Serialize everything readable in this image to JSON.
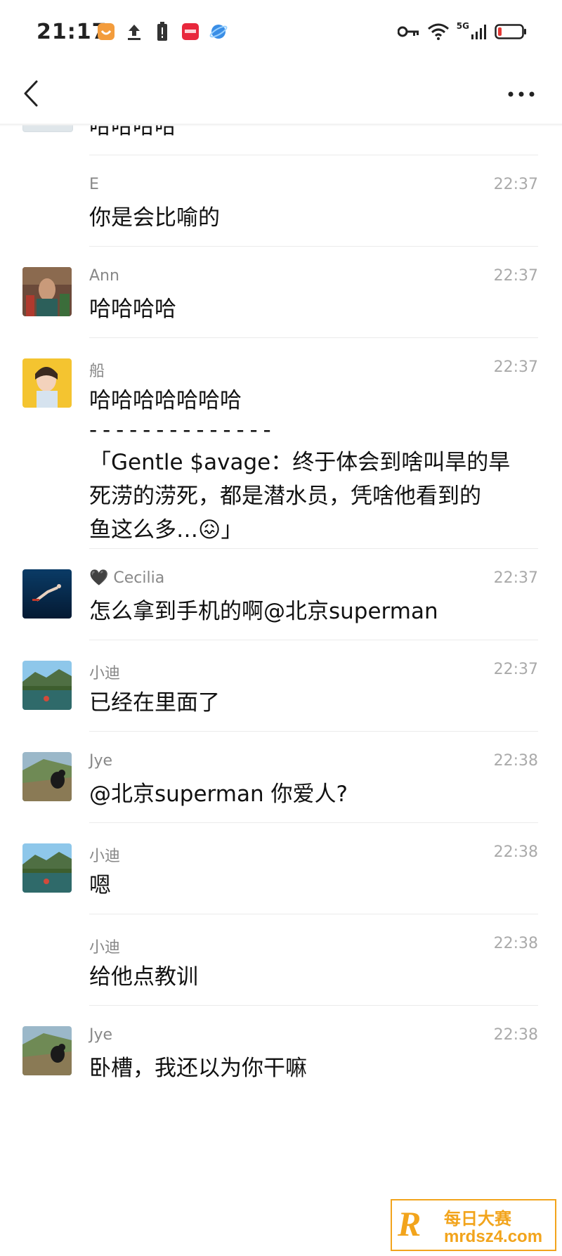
{
  "status_bar": {
    "time": "21:17",
    "network_type": "5G",
    "icons": [
      "app-notification-icon",
      "upload-icon",
      "alert-icon",
      "app-icon",
      "browser-icon",
      "key-icon",
      "wifi-icon",
      "signal-icon",
      "battery-low-icon"
    ],
    "battery_color": "#e53935"
  },
  "nav": {
    "back_icon": "chevron-left-icon",
    "more_icon": "more-dots-icon"
  },
  "messages": [
    {
      "sender": "",
      "time": "",
      "text": "哈哈哈哈",
      "avatar": "partial"
    },
    {
      "sender": "E",
      "time": "22:37",
      "text": "你是会比喻的",
      "avatar": "none"
    },
    {
      "sender": "Ann",
      "time": "22:37",
      "text": "哈哈哈哈",
      "avatar": "painting"
    },
    {
      "sender": "船",
      "time": "22:37",
      "text": "哈哈哈哈哈哈哈",
      "avatar": "portrait",
      "quote_separator": "- - - - - - - - - - - - - - -",
      "quote_lines": [
        "「Gentle $avage：终于体会到啥叫旱的旱",
        "死涝的涝死，都是潜水员，凭啥他看到的",
        "鱼这么多…😖」"
      ]
    },
    {
      "sender": "🖤 Cecilia",
      "time": "22:37",
      "text": "怎么拿到手机的啊@北京superman",
      "avatar": "diver"
    },
    {
      "sender": "小迪",
      "time": "22:37",
      "text": "已经在里面了",
      "avatar": "lake"
    },
    {
      "sender": "Jye",
      "time": "22:38",
      "text": "@北京superman 你爱人?",
      "avatar": "mountain"
    },
    {
      "sender": "小迪",
      "time": "22:38",
      "text": "嗯",
      "avatar": "lake"
    },
    {
      "sender": "小迪",
      "time": "22:38",
      "text": "给他点教训",
      "avatar": "none"
    },
    {
      "sender": "Jye",
      "time": "22:38",
      "text": "卧槽，我还以为你干嘛",
      "avatar": "mountain"
    }
  ],
  "watermark": {
    "logo": "R",
    "title": "每日大赛",
    "url": "mrdsz4.com",
    "color": "#f2a41c"
  }
}
